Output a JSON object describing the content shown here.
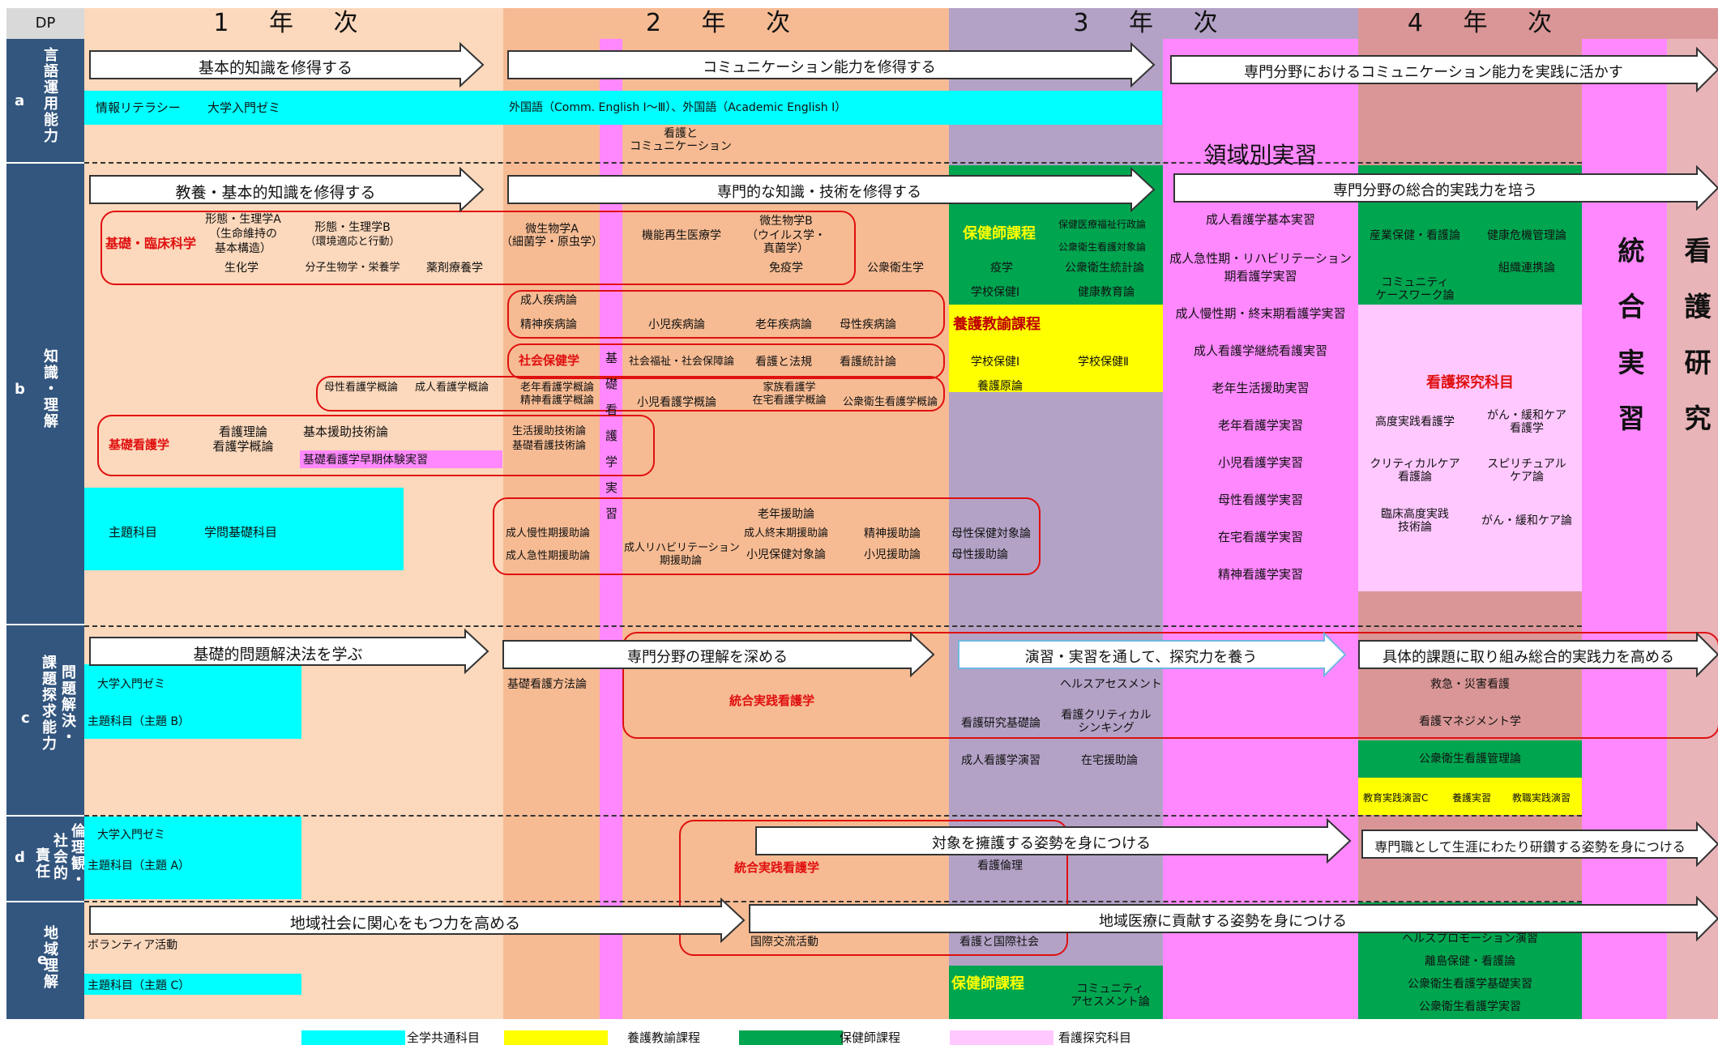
{
  "header": {
    "dp": "DP",
    "year1": "1 年 次",
    "year2": "2 年 次",
    "year3": "3 年 次",
    "year4": "4 年 次"
  },
  "dp": {
    "a_title": "言語運用能力",
    "a_letter": "a",
    "b_title": "知識・理解",
    "b_letter": "b",
    "c_title1": "課題探求能力",
    "c_title2": "問題解決・",
    "c_letter": "c",
    "d_title1": "責任",
    "d_title2": "社会的",
    "d_title3": "倫理観・",
    "d_letter": "d",
    "e_title": "地域理解",
    "e_letter": "e"
  },
  "arrows": {
    "a1": "基本的知識を修得する",
    "a2": "コミュニケーション能力を修得する",
    "a3": "専門分野におけるコミュニケーション能力を実践に活かす",
    "b1": "教養・基本的知識を修得する",
    "b2": "専門的な知識・技術を修得する",
    "b3": "専門分野の総合的実践力を培う",
    "c1": "基礎的問題解決法を学ぶ",
    "c2": "専門分野の理解を深める",
    "c3": "演習・実習を通して、探究力を養う",
    "c4": "具体的課題に取り組み総合的実践力を高める",
    "d1": "対象を擁護する姿勢を身につける",
    "d2": "専門職として生涯にわたり研鑽する姿勢を身につける",
    "e1": "地域社会に関心をもつ力を高める",
    "e2": "地域医療に貢献する姿勢を身につける"
  },
  "a": {
    "joho": "情報リテラシー",
    "zemi": "大学入門ゼミ",
    "gaikoku": "外国語（Comm. English Ⅰ～Ⅲ）、外国語（Academic English Ⅰ）",
    "kango_comm1": "看護と",
    "kango_comm2": "コミュニケーション"
  },
  "b": {
    "kiso_rinsho": "基礎・臨床科学",
    "keitai_a1": "形態・生理学A",
    "keitai_a2": "（生命維持の",
    "keitai_a3": "基本構造）",
    "keitai_b1": "形態・生理学B",
    "keitai_b2": "（環境適応と行動）",
    "seika": "生化学",
    "bunshi": "分子生物学・栄養学",
    "yakuzai": "薬剤療養学",
    "biseibutsu_a1": "微生物学A",
    "biseibutsu_a2": "（細菌学・原虫学）",
    "kinou": "機能再生医療学",
    "biseibutsu_b1": "微生物学B",
    "biseibutsu_b2": "（ウイルス学・",
    "biseibutsu_b3": "真菌学）",
    "meneki": "免疫学",
    "koshu_eisei": "公衆衛生学",
    "seijin_shippei": "成人疾病論",
    "seishin_shippei": "精神疾病論",
    "shoni_shippei": "小児疾病論",
    "ronen_shippei": "老年疾病論",
    "bosei_shippei": "母性疾病論",
    "shakai_hoken": "社会保健学",
    "shakai_fukushi": "社会福祉・社会保障論",
    "kango_hoki": "看護と法規",
    "kango_tokei": "看護統計論",
    "bosei_gairon": "母性看護学概論",
    "seijin_gairon": "成人看護学概論",
    "ronen_gairon": "老年看護学概論",
    "seishin_gairon": "精神看護学概論",
    "shoni_gairon": "小児看護学概論",
    "zaitaku_gairon1": "家族看護学",
    "zaitaku_gairon2": "在宅看護学概論",
    "koshu_gairon": "公衆衛生看護学概論",
    "kiso_kango": "基礎看護学",
    "kango_riron": "看護理論",
    "kango_gairon": "看護学概論",
    "kihon_engo": "基本援助技術論",
    "soki_taiken": "基礎看護学早期体験実習",
    "seikatsu_engo": "生活援助技術論",
    "kiso_gijutsu": "基礎看護技術論",
    "kiso_jisshu_v": "基礎看護学実習",
    "shudai": "主題科目",
    "gakumon": "学問基礎科目",
    "ronen_engo": "老年援助論",
    "seijin_mansei": "成人慢性期援助論",
    "seijin_kyusei": "成人急性期援助論",
    "seijin_rehab1": "成人リハビリテーション",
    "seijin_rehab2": "期援助論",
    "seijin_shumatsu": "成人終末期援助論",
    "shoni_hoken": "小児保健対象論",
    "seishin_engo": "精神援助論",
    "shoni_engo": "小児援助論",
    "bosei_hoken": "母性保健対象論",
    "bosei_engo": "母性援助論",
    "hokenshi": "保健師課程",
    "ekigaku": "疫学",
    "gakko_hoken1": "学校保健Ⅰ",
    "hoken_iryo": "保健医療福祉行政論",
    "koshu_taisho": "公衆衛生看護対象論",
    "koshu_tokei": "公衆衛生統計論",
    "kenko_kyoiku": "健康教育論",
    "yogo": "養護教諭課程",
    "gakko1": "学校保健Ⅰ",
    "gakko2": "学校保健Ⅱ",
    "yogo_genron": "養護原論",
    "ryoiki": "領域別実習",
    "j1": "成人看護学基本実習",
    "j2a": "成人急性期・リハビリテーション",
    "j2b": "期看護学実習",
    "j3": "成人慢性期・終末期看護学実習",
    "j4": "成人看護学継続看護実習",
    "j5": "老年生活援助実習",
    "j6": "老年看護学実習",
    "j7": "小児看護学実習",
    "j8": "母性看護学実習",
    "j9": "在宅看護学実習",
    "j10": "精神看護学実習",
    "sangyo": "産業保健・看護論",
    "kenko_kiki": "健康危機管理論",
    "community1": "コミュニティ",
    "community2": "ケースワーク論",
    "soshiki": "組織連携論",
    "tankyu": "看護探究科目",
    "kodo": "高度実践看護学",
    "gan1": "がん・緩和ケア",
    "gan2": "看護学",
    "critical1": "クリティカルケア",
    "critical2": "看護論",
    "spirit1": "スピリチュアル",
    "spirit2": "ケア論",
    "rinsho1": "臨床高度実践",
    "rinsho2": "技術論",
    "gan_care": "がん・緩和ケア論",
    "togo": "統合実習",
    "kenkyu": "看護研究"
  },
  "c": {
    "zemi": "大学入門ゼミ",
    "shudai_b": "主題科目（主題 B）",
    "kiso_hoho": "基礎看護方法論",
    "togo_jissen": "統合実践看護学",
    "health_assess": "ヘルスアセスメント",
    "kenkyu_kiso": "看護研究基礎論",
    "critical1": "看護クリティカル",
    "critical2": "シンキング",
    "seijin_enshu": "成人看護学演習",
    "zaitaku_engo": "在宅援助論",
    "kyumei": "救急・災害看護",
    "management": "看護マネジメント学",
    "koshu_kanri": "公衆衛生看護管理論",
    "kyoiku_c": "教育実践演習C",
    "yogo_jisshu": "養護実習",
    "kyoshoku": "教職実践演習"
  },
  "d": {
    "zemi": "大学入門ゼミ",
    "shudai_a": "主題科目（主題 A）",
    "togo_jissen": "統合実践看護学",
    "rinri": "看護倫理"
  },
  "e": {
    "volunteer": "ボランティア活動",
    "shudai_c": "主題科目（主題 C）",
    "kokusai": "国際交流活動",
    "kokusai_shakai": "看護と国際社会",
    "hokenshi": "保健師課程",
    "community1": "コミュニティ",
    "community2": "アセスメント論",
    "health_promo": "ヘルスプロモーション演習",
    "rito": "離島保健・看護論",
    "koshu_kiso": "公衆衛生看護学基礎実習",
    "koshu_jisshu": "公衆衛生看護学実習"
  },
  "legend": {
    "common": "全学共通科目",
    "yogo": "養護教諭課程",
    "hokenshi": "保健師課程",
    "tankyu": "看護探究科目"
  },
  "colors": {
    "dp_blue": "#33567f",
    "year1": "#fcd8bc",
    "year2": "#f6bb93",
    "year3": "#b3a2c6",
    "year4": "#da9696",
    "jisshu_pink": "#ff88ff",
    "cyan": "#00ffff",
    "yellow": "#ffff00",
    "green": "#00a550",
    "tankyu_pink": "#ffc8ff",
    "red": "#e01010"
  }
}
